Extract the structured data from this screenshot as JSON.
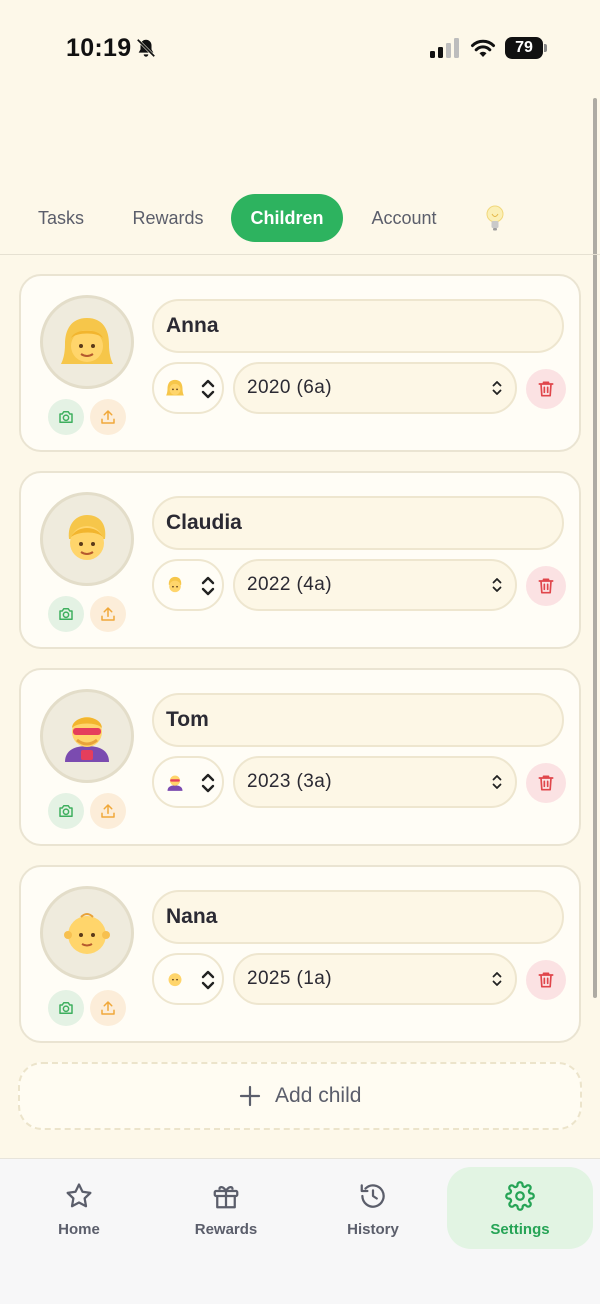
{
  "status_bar": {
    "time": "10:19",
    "battery": "79",
    "icons": [
      "bell-slash-icon",
      "cellular-signal-icon",
      "wifi-icon",
      "battery-icon"
    ]
  },
  "tabs": [
    {
      "label": "Tasks",
      "active": false
    },
    {
      "label": "Rewards",
      "active": false
    },
    {
      "label": "Children",
      "active": true
    },
    {
      "label": "Account",
      "active": false
    }
  ],
  "tab_tip_icon": "lightbulb-icon",
  "children": [
    {
      "name": "Anna",
      "emoji": "girl-blonde-icon",
      "year": "2020 (6a)"
    },
    {
      "name": "Claudia",
      "emoji": "child-icon",
      "year": "2022 (4a)"
    },
    {
      "name": "Tom",
      "emoji": "superhero-icon",
      "year": "2023 (3a)"
    },
    {
      "name": "Nana",
      "emoji": "baby-icon",
      "year": "2025 (1a)"
    }
  ],
  "add_child": {
    "label": "Add child",
    "icon": "plus-icon"
  },
  "bottom_nav": [
    {
      "label": "Home",
      "icon": "star-icon",
      "active": false
    },
    {
      "label": "Rewards",
      "icon": "gift-icon",
      "active": false
    },
    {
      "label": "History",
      "icon": "history-icon",
      "active": false
    },
    {
      "label": "Settings",
      "icon": "gear-icon",
      "active": true
    }
  ],
  "colors": {
    "background": "#FDF8E9",
    "accent_green": "#2DB35F",
    "delete_red": "#E0464B",
    "text": "#2B2A33"
  }
}
